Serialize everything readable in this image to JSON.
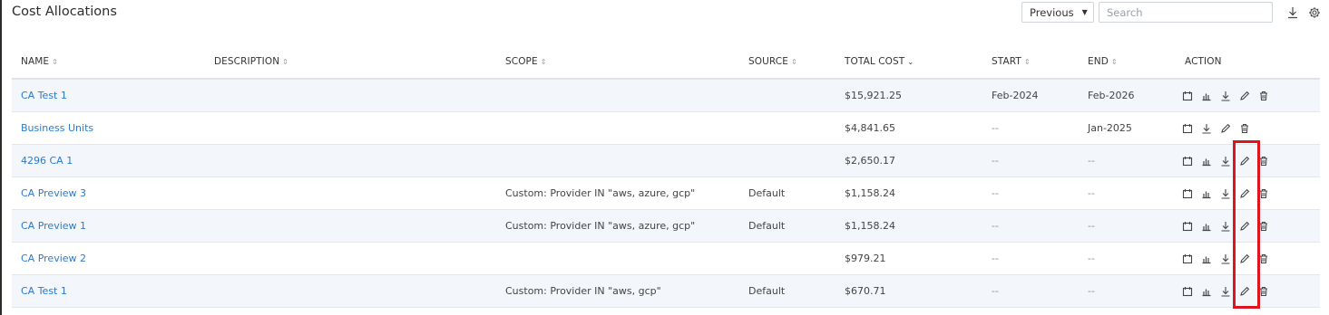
{
  "header": {
    "title": "Cost Allocations",
    "range_select": "Previous",
    "search_placeholder": "Search",
    "download_icon": "download-icon",
    "settings_icon": "gear-icon"
  },
  "table": {
    "columns": [
      "NAME",
      "DESCRIPTION",
      "SCOPE",
      "SOURCE",
      "TOTAL COST",
      "START",
      "END",
      "ACTION"
    ],
    "sorted_column": "TOTAL COST",
    "rows": [
      {
        "name": "CA Test 1",
        "description": "",
        "scope": "",
        "source": "",
        "total_cost": "$15,921.25",
        "start": "Feb-2024",
        "end": "Feb-2026",
        "actions": [
          "copy-icon",
          "chart-icon",
          "download-icon",
          "edit-icon",
          "trash-icon"
        ]
      },
      {
        "name": "Business Units",
        "description": "",
        "scope": "",
        "source": "",
        "total_cost": "$4,841.65",
        "start": "--",
        "end": "Jan-2025",
        "actions": [
          "copy-icon",
          "download-icon",
          "edit-icon",
          "trash-icon"
        ]
      },
      {
        "name": "4296 CA 1",
        "description": "",
        "scope": "",
        "source": "",
        "total_cost": "$2,650.17",
        "start": "--",
        "end": "--",
        "actions": [
          "copy-icon",
          "chart-icon",
          "download-icon",
          "edit-icon",
          "trash-icon"
        ]
      },
      {
        "name": "CA Preview 3",
        "description": "",
        "scope": "Custom: Provider IN \"aws, azure, gcp\"",
        "source": "Default",
        "total_cost": "$1,158.24",
        "start": "--",
        "end": "--",
        "actions": [
          "copy-icon",
          "chart-icon",
          "download-icon",
          "edit-icon",
          "trash-icon"
        ]
      },
      {
        "name": "CA Preview 1",
        "description": "",
        "scope": "Custom: Provider IN \"aws, azure, gcp\"",
        "source": "Default",
        "total_cost": "$1,158.24",
        "start": "--",
        "end": "--",
        "actions": [
          "copy-icon",
          "chart-icon",
          "download-icon",
          "edit-icon",
          "trash-icon"
        ]
      },
      {
        "name": "CA Preview 2",
        "description": "",
        "scope": "",
        "source": "",
        "total_cost": "$979.21",
        "start": "--",
        "end": "--",
        "actions": [
          "copy-icon",
          "chart-icon",
          "download-icon",
          "edit-icon",
          "trash-icon"
        ]
      },
      {
        "name": "CA Test 1",
        "description": "",
        "scope": "Custom: Provider IN \"aws, gcp\"",
        "source": "Default",
        "total_cost": "$670.71",
        "start": "--",
        "end": "--",
        "actions": [
          "copy-icon",
          "chart-icon",
          "download-icon",
          "edit-icon",
          "trash-icon"
        ]
      }
    ]
  },
  "colors": {
    "link": "#2a7bd3",
    "row_alt": "#f3f6fa",
    "highlight": "#e0141e"
  }
}
